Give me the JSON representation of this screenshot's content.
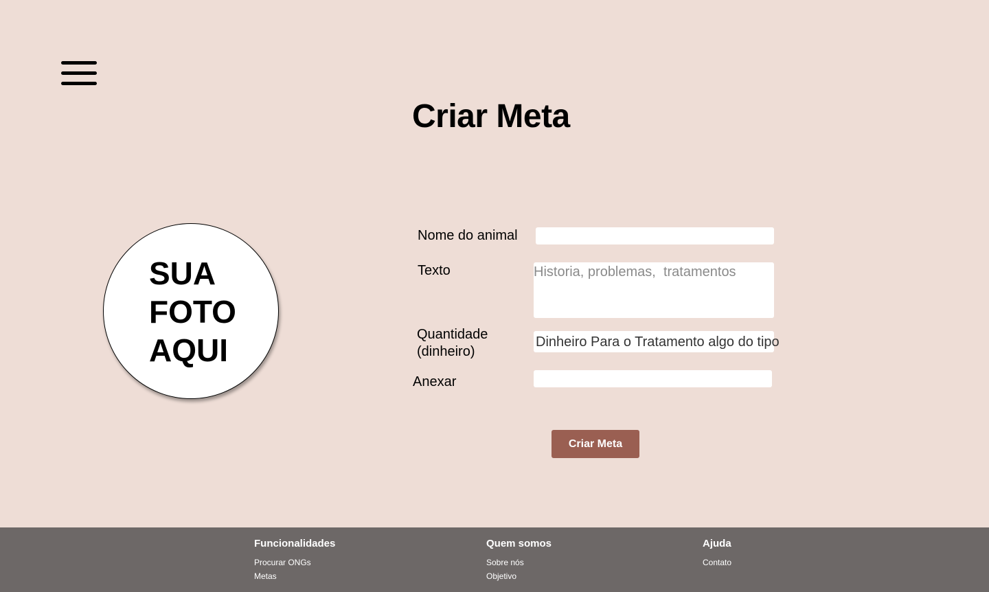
{
  "header": {
    "menu_icon": "hamburger-menu-icon",
    "title": "Criar Meta"
  },
  "photo": {
    "text": "SUA\nFOTO\nAQUI"
  },
  "form": {
    "nome": {
      "label": "Nome do animal",
      "value": ""
    },
    "texto": {
      "label": "Texto",
      "placeholder": "Historia, problemas,  tratamentos"
    },
    "quantidade": {
      "label": "Quantidade (dinheiro)",
      "value": "Dinheiro Para o Tratamento algo do tipo"
    },
    "anexar": {
      "label": "Anexar"
    },
    "submit_label": "Criar Meta"
  },
  "footer": {
    "columns": [
      {
        "heading": "Funcionalidades",
        "links": [
          "Procurar ONGs",
          "Metas"
        ]
      },
      {
        "heading": "Quem somos",
        "links": [
          "Sobre nós",
          "Objetivo"
        ]
      },
      {
        "heading": "Ajuda",
        "links": [
          "Contato"
        ]
      }
    ]
  },
  "colors": {
    "background": "#eeddd6",
    "button": "#9a5f52",
    "footer": "#6d6867"
  }
}
